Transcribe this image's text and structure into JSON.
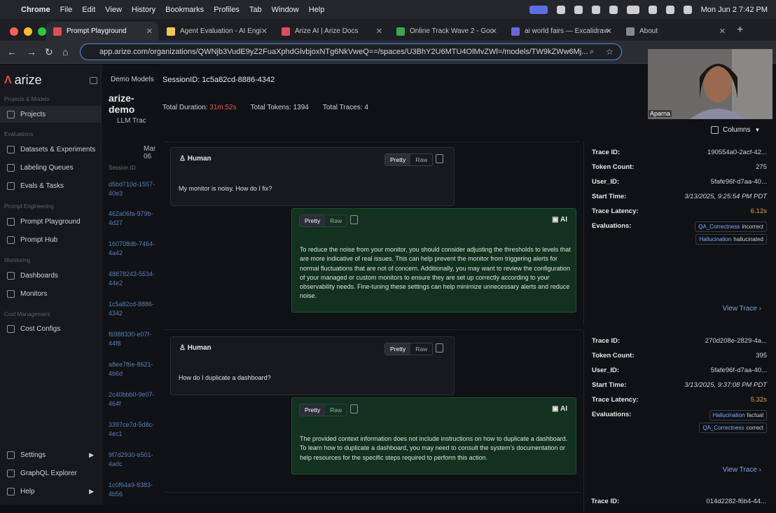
{
  "macos": {
    "app": "Chrome",
    "menus": [
      "File",
      "Edit",
      "View",
      "History",
      "Bookmarks",
      "Profiles",
      "Tab",
      "Window",
      "Help"
    ],
    "clock": "Mon Jun 2  7:42 PM"
  },
  "tabs": [
    {
      "label": "Prompt Playground",
      "active": true,
      "color": "#e04d5a"
    },
    {
      "label": "Agent Evaluation - AI Engi",
      "active": false,
      "color": "#f2c94c"
    },
    {
      "label": "Arize AI | Arize Docs",
      "active": false,
      "color": "#e04d5a"
    },
    {
      "label": "Online Track Wave 2 - Goo",
      "active": false,
      "color": "#34a853"
    },
    {
      "label": "ai world fairs — Excalidraw",
      "active": false,
      "color": "#6965db"
    },
    {
      "label": "About",
      "active": false,
      "color": "#888888"
    }
  ],
  "address": {
    "url": "app.arize.com/organizations/QWNjb3VudE9yZ2FuaXphdGlvbjoxNTg6NkVweQ==/spaces/U3BhY2U6MTU4OlMvZWl=/models/TW9kZWw6Mj..."
  },
  "sidebar": {
    "brand": "arize",
    "sections": {
      "projects": "Projects & Models",
      "evaluations": "Evaluations",
      "prompt": "Prompt Engineering",
      "monitoring": "Monitoring",
      "cost": "Cost Management"
    },
    "items": {
      "projects": "Projects",
      "datasets": "Datasets & Experiments",
      "labeling": "Labeling Queues",
      "evals": "Evals & Tasks",
      "playground": "Prompt Playground",
      "hub": "Prompt Hub",
      "dashboards": "Dashboards",
      "monitors": "Monitors",
      "cost": "Cost Configs",
      "settings": "Settings",
      "graphql": "GraphQL Explorer",
      "help": "Help"
    }
  },
  "col2": {
    "demo": "Demo Models",
    "title": "arize-demo",
    "llm": "LLM Trac",
    "date": "Mar 06",
    "session_hdr": "Session ID",
    "ids": [
      "d5bd710d-1557-40e3",
      "462a06fa-979b-4d27",
      "160708db-7464-4a42",
      "48878243-5534-44e2",
      "1c5a82cd-8886-4342",
      "f6988330-e07f-44f8",
      "a8ee7f6e-8621-4b6d",
      "2c40bbb0-9e07-464f",
      "3397ce7d-5d8c-4ec1",
      "9f7d2930-e501-4adc",
      "1c0f64a9-8383-4b56"
    ]
  },
  "session": {
    "title": "SessionID: 1c5a82cd-8886-4342",
    "duration_label": "Total Duration:",
    "duration": "31m:52s",
    "tokens_label": "Total Tokens:",
    "tokens": "1394",
    "traces_label": "Total Traces:",
    "traces": "4",
    "columns": "Columns"
  },
  "toggle": {
    "pretty": "Pretty",
    "raw": "Raw"
  },
  "roles": {
    "human": "Human",
    "ai": "AI"
  },
  "conversations": [
    {
      "human": "My monitor is noisy. How do I fix?",
      "ai": "To reduce the noise from your monitor, you should consider adjusting the thresholds to levels that are more indicative of real issues. This can help prevent the monitor from triggering alerts for normal fluctuations that are not of concern. Additionally, you may want to review the configuration of your managed or custom monitors to ensure they are set up correctly according to your observability needs. Fine-tuning these settings can help minimize unnecessary alerts and reduce noise.",
      "trace_id": "190554a0-2acf-42...",
      "token_count": "275",
      "user_id": "5fafe96f-d7aa-40...",
      "start_time": "3/13/2025, 9:25:54 PM PDT",
      "latency": "6.12s",
      "evals": [
        {
          "name": "QA_Correctness",
          "value": "incorrect"
        },
        {
          "name": "Hallucination",
          "value": "hallucinated"
        }
      ]
    },
    {
      "human": "How do I duplicate a dashboard?",
      "ai": "The provided context information does not include instructions on how to duplicate a dashboard. To learn how to duplicate a dashboard, you may need to consult the system's documentation or help resources for the specific steps required to perform this action.",
      "trace_id": "270d208e-2829-4a...",
      "token_count": "395",
      "user_id": "5fafe96f-d7aa-40...",
      "start_time": "3/13/2025, 9:37:08 PM PDT",
      "latency": "5.32s",
      "evals": [
        {
          "name": "Hallucination",
          "value": "factual"
        },
        {
          "name": "QA_Correctness",
          "value": "correct"
        }
      ]
    }
  ],
  "next_trace_id": "014d2282-f6b4-44...",
  "labels": {
    "trace_id": "Trace ID:",
    "token_count": "Token Count:",
    "user_id": "User_ID:",
    "start_time": "Start Time:",
    "latency": "Trace Latency:",
    "evaluations": "Evaluations:",
    "view_trace": "View Trace"
  },
  "video": {
    "name": "Aparna"
  }
}
